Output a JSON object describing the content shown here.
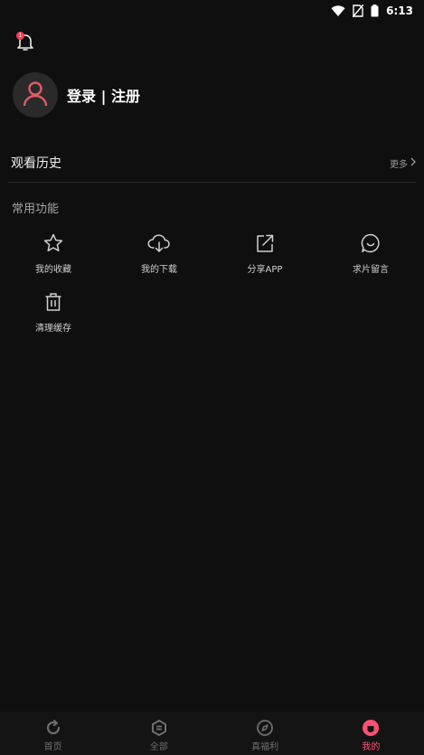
{
  "status_bar": {
    "time": "6:13"
  },
  "notification": {
    "badge": "1"
  },
  "profile": {
    "login_label": "登录 | 注册"
  },
  "history": {
    "title": "观看历史",
    "more_label": "更多"
  },
  "functions": {
    "section_title": "常用功能",
    "items": [
      {
        "label": "我的收藏",
        "icon": "star-icon"
      },
      {
        "label": "我的下载",
        "icon": "cloud-download-icon"
      },
      {
        "label": "分享APP",
        "icon": "share-icon"
      },
      {
        "label": "求片留言",
        "icon": "chat-bubble-icon"
      },
      {
        "label": "清理缓存",
        "icon": "trash-icon"
      }
    ]
  },
  "tabbar": {
    "items": [
      {
        "label": "首页",
        "icon": "home-refresh-icon",
        "active": false
      },
      {
        "label": "全部",
        "icon": "category-icon",
        "active": false
      },
      {
        "label": "真福利",
        "icon": "compass-icon",
        "active": false
      },
      {
        "label": "我的",
        "icon": "profile-icon",
        "active": true
      }
    ]
  },
  "colors": {
    "accent": "#ff4f73",
    "background": "#0f0f0f",
    "badge": "#ff3b5c"
  }
}
